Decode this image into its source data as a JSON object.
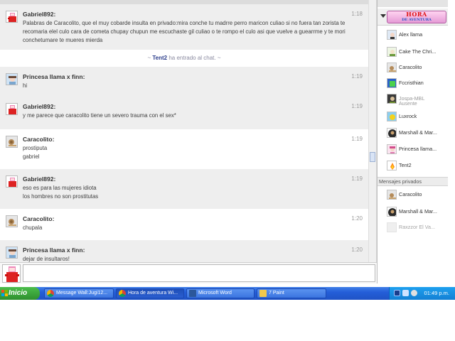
{
  "chat": {
    "messages": [
      {
        "user": "Gabriel892:",
        "time": "1:18",
        "lines": [
          "Palabras de Caracolito, que el muy cobarde insulta en privado:mira conche tu madrre perro maricon culiao si no fuera tan zorista te recomaria elel culo cara de cometa chupay chupun me escuchaste gil culiao o te rompo el culo asi que vuelve a guearrme y te mori conchetumare te mueres mierda"
        ]
      },
      {
        "user": "Princesa llama x finn:",
        "time": "1:19",
        "lines": [
          "hi"
        ]
      },
      {
        "user": "Gabriel892:",
        "time": "1:19",
        "lines": [
          "y me parece que caracolito tiene un severo trauma con el sex*"
        ]
      },
      {
        "user": "Caracolito:",
        "time": "1:19",
        "lines": [
          "prostiputa",
          "gabriel"
        ]
      },
      {
        "user": "Gabriel892:",
        "time": "1:19",
        "lines": [
          "eso es para las mujeres idiota",
          "los hombres no son prostitutas"
        ]
      },
      {
        "user": "Caracolito:",
        "time": "1:20",
        "lines": [
          "chupala"
        ]
      },
      {
        "user": "Princesa llama x finn:",
        "time": "1:20",
        "lines": [
          "dejar de insultaros!"
        ]
      }
    ],
    "join_notice": {
      "prefix": "~ ",
      "user": "Tent2",
      "rest": " ha entrado al chat. ~"
    }
  },
  "input": {
    "placeholder": "",
    "value": ""
  },
  "sidebar": {
    "room_logo_line1": "HORA",
    "room_logo_line2": "DE AVENTURA",
    "users": [
      {
        "name": "Alex llama",
        "sub": "",
        "avatar": "llama-girl-avatar"
      },
      {
        "name": "Cake The Chri...",
        "sub": "",
        "avatar": "cake-avatar"
      },
      {
        "name": "Caracolito",
        "sub": "",
        "avatar": "snail-avatar"
      },
      {
        "name": "Fccristhian",
        "sub": "",
        "avatar": "green-square-avatar"
      },
      {
        "name": "Jospa-MBL",
        "sub": "Ausente",
        "avatar": "dark-avatar",
        "away": true
      },
      {
        "name": "Luxrock",
        "sub": "",
        "avatar": "yellow-avatar"
      },
      {
        "name": "Marshall & Mar...",
        "sub": "",
        "avatar": "dark-circle-avatar"
      },
      {
        "name": "Princesa llama...",
        "sub": "",
        "avatar": "pink-girl-avatar"
      },
      {
        "name": "Tent2",
        "sub": "",
        "avatar": "flame-avatar"
      }
    ],
    "private_header": "Mensajes privados",
    "private_users": [
      {
        "name": "Caracolito",
        "avatar": "snail-avatar"
      },
      {
        "name": "Marshall & Mar...",
        "avatar": "dark-circle-avatar"
      },
      {
        "name": "Raxzzor El Va...",
        "avatar": "blank-avatar",
        "faded": true
      }
    ]
  },
  "taskbar": {
    "start_label": "Inicio",
    "tasks": [
      {
        "label": "Message Wall:Jugi12...",
        "icon": "chrome-icon"
      },
      {
        "label": "Hora de aventura Wi...",
        "icon": "chrome-icon",
        "active": true
      },
      {
        "label": "Microsoft Word",
        "icon": "word-icon"
      },
      {
        "label": "7 Paint",
        "icon": "paint-icon"
      }
    ],
    "clock": "01:49 p.m."
  },
  "colors": {
    "taskbar_blue": "#245ed8",
    "start_green": "#3aa63a",
    "join_user": "#2e3f8c",
    "logo_red": "#dd1111"
  }
}
